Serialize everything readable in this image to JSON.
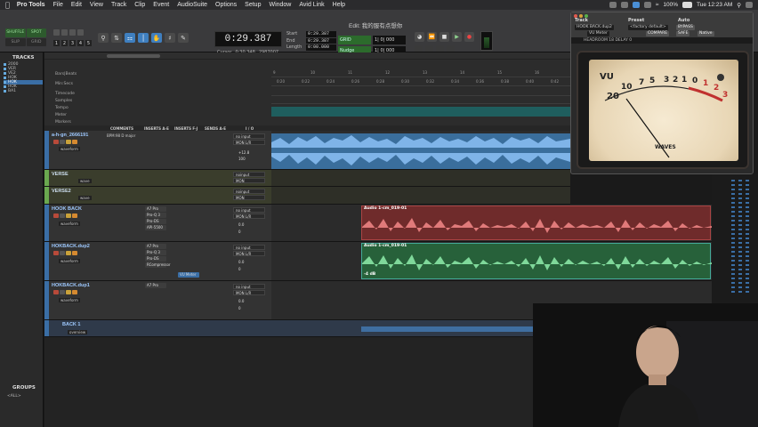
{
  "menubar": {
    "app": "Pro Tools",
    "items": [
      "File",
      "Edit",
      "View",
      "Track",
      "Clip",
      "Event",
      "AudioSuite",
      "Options",
      "Setup",
      "Window",
      "Avid Link",
      "Help"
    ],
    "battery": "100%",
    "clock": "Tue 12:23 AM"
  },
  "toolbar": {
    "edit_title": "Edit: 我的服有点想你",
    "modes": [
      "SHUFFLE",
      "SPOT",
      "SLIP",
      "GRID"
    ],
    "zoom_presets": [
      "1",
      "2",
      "3",
      "4",
      "5"
    ],
    "counter": "0:29.387",
    "cursor_label": "Cursor",
    "cursor_value": "0:30.348",
    "cursor_sample": "2987007",
    "start_label": "Start",
    "end_label": "End",
    "length_label": "Length",
    "start": "0:29.387",
    "end": "0:29.387",
    "length": "0:00.000",
    "nudge_label": "Nudge",
    "grid_value": "1| 0| 000",
    "nudge_value": "1| 0| 000"
  },
  "plugin": {
    "track_label": "Track",
    "preset_label": "Preset",
    "auto_label": "Auto",
    "track_value": "HOOK BACK.dup2",
    "preset_value": "<factory default>",
    "plugin_name": "VU Meter",
    "compare": "COMPARE",
    "safe": "SAFE",
    "bypass": "BYPASS",
    "native": "Native",
    "ctrl_readout": "HEADROOM 18 DELAY 0",
    "vu_label": "VU",
    "scale": [
      "20",
      "10",
      "7",
      "5",
      "3",
      "2",
      "1",
      "0",
      "1",
      "2",
      "3"
    ],
    "brand": "WAVES"
  },
  "tracks_panel": {
    "title": "TRACKS",
    "items": [
      "2000",
      "VER",
      "VE2",
      "HOK",
      "HOK",
      "HOK",
      "BA1"
    ],
    "groups_title": "GROUPS",
    "groups_all": "<ALL>"
  },
  "rulers": {
    "labels": [
      "Bars|Beats",
      "Min:Secs",
      "Timecode",
      "Samples",
      "Tempo",
      "Meter",
      "Markers"
    ],
    "bars": [
      "9",
      "10",
      "11",
      "12",
      "13",
      "14",
      "15",
      "16"
    ],
    "mins": [
      "0:20",
      "0:22",
      "0:24",
      "0:26",
      "0:28",
      "0:30",
      "0:32",
      "0:34",
      "0:36",
      "0:38",
      "0:40",
      "0:42"
    ]
  },
  "columns": {
    "comments": "COMMENTS",
    "inserts_ae": "INSERTS A-E",
    "inserts_fj": "INSERTS F-J",
    "sends_ae": "SENDS A-E",
    "io": "I / O"
  },
  "tracks": [
    {
      "name": "a-h-gn_2666191",
      "comment": "BPM:98  D major",
      "mode": "waveform",
      "inserts": [],
      "io": [
        "no input",
        "MON L/R"
      ],
      "vol": "+12.8",
      "pan": "100"
    },
    {
      "name": "VERSE",
      "mode": "wave",
      "inserts": [],
      "io": [
        "noinput",
        "MON"
      ],
      "vol": "-6.0",
      "pan": "0"
    },
    {
      "name": "VERSE2",
      "mode": "wave",
      "inserts": [],
      "io": [
        "noinput",
        "MON"
      ],
      "vol": "0.0",
      "pan": "0"
    },
    {
      "name": "HOOK BACK",
      "mode": "waveform",
      "inserts": [
        "A7 Pro",
        "Pro-Q 3",
        "Pro-DS",
        "API-5500"
      ],
      "io": [
        "no input",
        "MON L/R"
      ],
      "vol": "0.0",
      "pan": "0"
    },
    {
      "name": "HOKBACK.dup2",
      "mode": "waveform",
      "inserts": [
        "A7 Pro",
        "Pro-Q 3",
        "Pro-DS",
        "RCompressor"
      ],
      "extra_insert": "VU Meter",
      "io": [
        "no input",
        "MON L/R"
      ],
      "vol": "0.0",
      "pan": "0"
    },
    {
      "name": "HOKBACK.dup1",
      "mode": "waveform",
      "inserts": [
        "A7 Pro"
      ],
      "io": [
        "no input",
        "MON L/R"
      ],
      "vol": "0.0",
      "pan": "0"
    },
    {
      "name": "BACK 1",
      "mode": "overview",
      "inserts": [],
      "io": [],
      "vol": "",
      "pan": ""
    }
  ],
  "clips": {
    "red": "Audio 1-cm_019-01",
    "green": "Audio 1-cm_019-01",
    "green_db": "-4 dB"
  }
}
